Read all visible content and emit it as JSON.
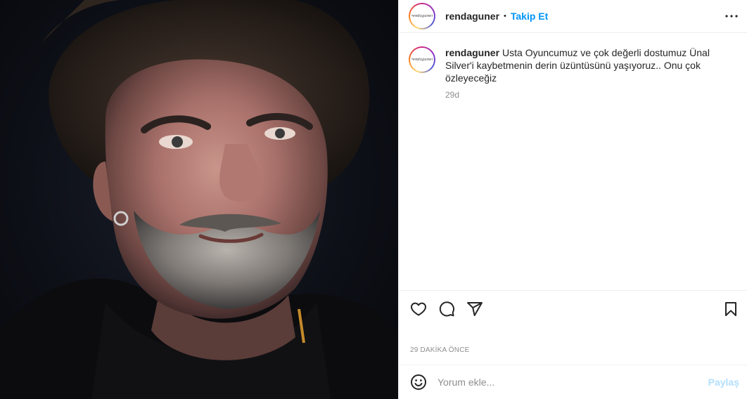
{
  "post": {
    "username": "rendaguner",
    "separator": "•",
    "follow_label": "Takip Et",
    "avatar_logo_text": "rendaguner",
    "more_icon": "more-horizontal-icon",
    "photo_alt": "portrait-photo"
  },
  "caption": {
    "username": "rendaguner",
    "text": "Usta Oyuncumuz ve çok değerli dostumuz Ünal Silver'i kaybetmenin derin üzüntüsünü yaşıyoruz.. Onu çok özleyeceğiz",
    "time": "29d"
  },
  "actions": {
    "like_icon": "heart-icon",
    "comment_icon": "comment-icon",
    "share_icon": "send-icon",
    "save_icon": "bookmark-icon"
  },
  "timestamp": "29 DAKİKA ÖNCE",
  "comment_bar": {
    "emoji_icon": "emoji-icon",
    "placeholder": "Yorum ekle...",
    "post_label": "Paylaş"
  },
  "colors": {
    "link": "#0095f6",
    "post_disabled": "#b2dffc",
    "muted": "#8e8e8e",
    "border": "#efefef"
  }
}
